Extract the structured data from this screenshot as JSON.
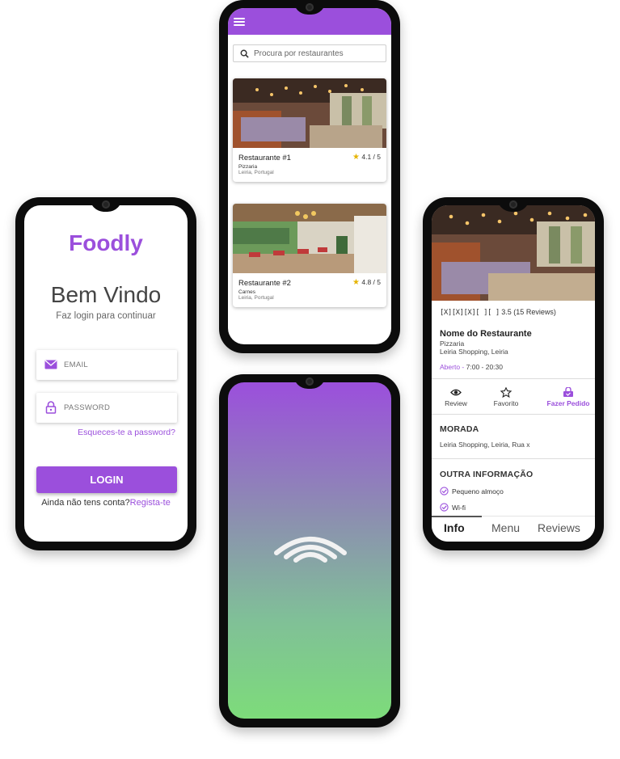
{
  "colors": {
    "accent": "#9b4fdc",
    "gradient_top": "#9b4fdc",
    "gradient_bottom": "#7ddc7a",
    "star": "#e6b400"
  },
  "login": {
    "logo": "Foodly",
    "welcome": "Bem Vindo",
    "subtitle": "Faz login para continuar",
    "email_placeholder": "EMAIL",
    "email_icon": "envelope-icon",
    "password_placeholder": "PASSWORD",
    "password_icon": "lock-icon",
    "forgot": "Esqueces-te a password?",
    "login_button": "LOGIN",
    "no_account": "Ainda não tens conta?",
    "register_link": "Regista-te"
  },
  "list": {
    "menu_icon": "hamburger-icon",
    "search_icon": "search-icon",
    "search_placeholder": "Procura por restaurantes",
    "restaurants": [
      {
        "name": "Restaurante #1",
        "rating": "4.1 / 5",
        "type": "Pizzaria",
        "location": "Leiria, Portugal"
      },
      {
        "name": "Restaurante #2",
        "rating": "4.8 / 5",
        "type": "Carnes",
        "location": "Leiria, Portugal"
      }
    ]
  },
  "splash": {
    "logo_icon": "foodly-arcs-icon"
  },
  "detail": {
    "stars": "[X][X][X][ ][ ]",
    "rating_text": "3.5 (15 Reviews)",
    "name": "Nome do Restaurante",
    "category": "Pizzaria",
    "address": "Leiria Shopping, Leiria",
    "open_label": "Aberto -",
    "hours": "7:00 - 20:30",
    "actions": [
      {
        "label": "Review",
        "icon": "eye-icon"
      },
      {
        "label": "Favorito",
        "icon": "star-outline-icon"
      },
      {
        "label": "Fazer Pedido",
        "icon": "order-icon"
      }
    ],
    "address_title": "MORADA",
    "full_address": "Leiria Shopping, Leiria, Rua x",
    "info_title": "OUTRA INFORMAÇÃO",
    "amenities": [
      "Pequeno almoço",
      "Wi-fi"
    ],
    "tabs": [
      "Info",
      "Menu",
      "Reviews"
    ],
    "active_tab": "Info"
  }
}
